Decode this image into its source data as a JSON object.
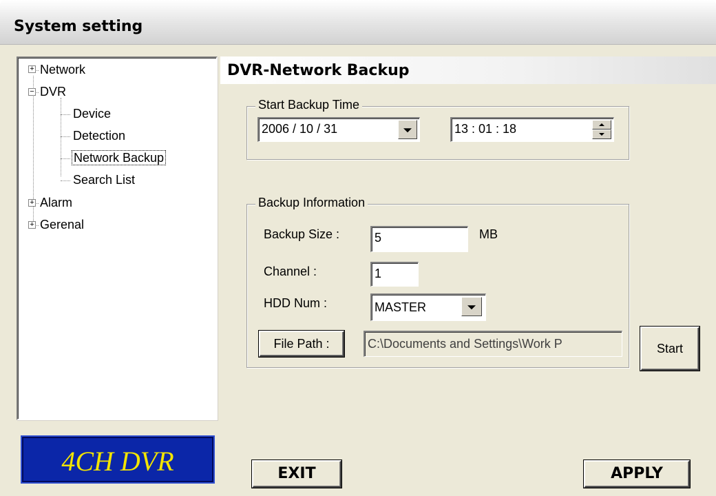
{
  "window": {
    "title": "System setting"
  },
  "tree": {
    "items": [
      {
        "label": "Network",
        "expander": "+"
      },
      {
        "label": "DVR",
        "expander": "−"
      },
      {
        "label": "Device"
      },
      {
        "label": "Detection"
      },
      {
        "label": "Network Backup",
        "selected": true
      },
      {
        "label": "Search List"
      },
      {
        "label": "Alarm",
        "expander": "+"
      },
      {
        "label": "Gerenal",
        "expander": "+"
      }
    ]
  },
  "logo": {
    "text": "4CH DVR"
  },
  "section": {
    "title": "DVR-Network Backup"
  },
  "start_backup_time": {
    "label": "Start Backup Time",
    "date": "2006 / 10 / 31",
    "time": "13 : 01 : 18"
  },
  "backup_info": {
    "label": "Backup Information",
    "size_label": "Backup Size :",
    "size_value": "5",
    "size_unit": "MB",
    "channel_label": "Channel :",
    "channel_value": "1",
    "hdd_label": "HDD Num :",
    "hdd_value": "MASTER",
    "file_path_button": "File Path :",
    "file_path_value": "C:\\Documents and Settings\\Work P"
  },
  "buttons": {
    "start": "Start",
    "exit": "EXIT",
    "apply": "APPLY"
  },
  "colors": {
    "logo_bg": "#0b26a8",
    "logo_text": "#f2e400",
    "window_bg": "#ece9d8"
  }
}
